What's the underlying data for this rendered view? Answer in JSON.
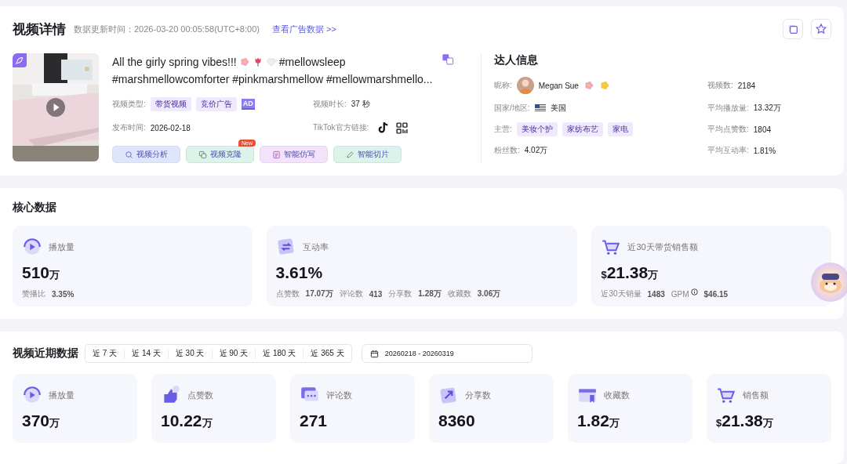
{
  "header": {
    "title": "视频详情",
    "update_time": "数据更新时间：2026-03-20 00:05:58(UTC+8:00)",
    "ad_link": "查看广告数据 >>"
  },
  "video": {
    "title_start": "All the girly spring vibes!!!",
    "title_tag": "#mellowsleep",
    "title_line2": "#marshmellowcomforter #pinkmarshmellow #mellowmarshmello...",
    "type_label": "视频类型:",
    "types": [
      "带货视频",
      "竞价广告"
    ],
    "ad_mark": "AD",
    "duration_label": "视频时长:",
    "duration": "37 秒",
    "publish_label": "发布时间:",
    "publish": "2026-02-18",
    "link_label": "TikTok官方链接:",
    "actions": [
      {
        "label": "视频分析",
        "color": "#dfe6fb"
      },
      {
        "label": "视频克隆",
        "color": "#dcf3ea",
        "badge": "New"
      },
      {
        "label": "智能仿写",
        "color": "#f3e2fa"
      },
      {
        "label": "智能切片",
        "color": "#dcf3ea"
      }
    ]
  },
  "creator": {
    "title": "达人信息",
    "nickname_label": "昵称:",
    "nickname": "Megan Sue",
    "country_label": "国家/地区:",
    "country": "美国",
    "main_label": "主营:",
    "categories": [
      "美妆个护",
      "家纺布艺",
      "家电"
    ],
    "fans_label": "粉丝数:",
    "fans": "4.02万",
    "stats": [
      {
        "label": "视频数:",
        "value": "2184"
      },
      {
        "label": "平均播放量:",
        "value": "13.32万"
      },
      {
        "label": "平均点赞数:",
        "value": "1804"
      },
      {
        "label": "平均互动率:",
        "value": "1.81%"
      }
    ]
  },
  "core": {
    "title": "核心数据",
    "cards": [
      {
        "label": "播放量",
        "value": "510",
        "unit": "万",
        "details": [
          {
            "label": "赞播比",
            "value": "3.35%"
          }
        ]
      },
      {
        "label": "互动率",
        "value": "3.61%",
        "details": [
          {
            "label": "点赞数",
            "value": "17.07万"
          },
          {
            "label": "评论数",
            "value": "413"
          },
          {
            "label": "分享数",
            "value": "1.28万"
          },
          {
            "label": "收藏数",
            "value": "3.06万"
          }
        ]
      },
      {
        "label": "近30天带货销售额",
        "prefix": "$",
        "value": "21.38",
        "unit": "万",
        "details": [
          {
            "label": "近30天销量",
            "value": "1483"
          },
          {
            "label": "GPM",
            "value": "$46.15",
            "info": true
          }
        ]
      }
    ]
  },
  "recent": {
    "title": "视频近期数据",
    "ranges": [
      {
        "label": "近 7 天",
        "selected": false
      },
      {
        "label": "近 14 天",
        "selected": false
      },
      {
        "label": "近 30 天",
        "selected": false
      },
      {
        "label": "近 90 天",
        "selected": false
      },
      {
        "label": "近 180 天",
        "selected": false
      },
      {
        "label": "近 365 天",
        "selected": false
      }
    ],
    "date_range": "20260218 - 20260319",
    "cards": [
      {
        "label": "播放量",
        "value": "370",
        "unit": "万"
      },
      {
        "label": "点赞数",
        "value": "10.22",
        "unit": "万"
      },
      {
        "label": "评论数",
        "value": "271"
      },
      {
        "label": "分享数",
        "value": "8360"
      },
      {
        "label": "收藏数",
        "value": "1.82",
        "unit": "万"
      },
      {
        "label": "销售额",
        "prefix": "$",
        "value": "21.38",
        "unit": "万"
      }
    ]
  }
}
